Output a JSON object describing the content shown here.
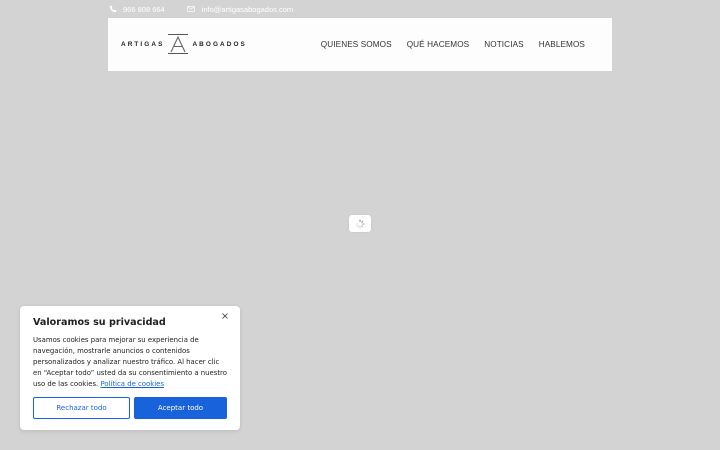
{
  "topbar": {
    "phone": "966 808 664",
    "phone_icon": "phone-icon",
    "email": "info@artigasabogados.com",
    "email_icon": "envelope-icon"
  },
  "header": {
    "logo_left": "ARTIGAS",
    "logo_right": "ABOGADOS",
    "logo_mark": "A",
    "nav": [
      "QUIENES SOMOS",
      "QUÉ HACEMOS",
      "NOTICIAS",
      "HABLEMOS"
    ]
  },
  "loader": {
    "icon": "spinner-icon"
  },
  "cookie": {
    "title": "Valoramos su privacidad",
    "body": "Usamos cookies para mejorar su experiencia de navegación, mostrarle anuncios o contenidos personalizados y analizar nuestro tráfico. Al hacer clic en “Aceptar todo” usted da su consentimiento a nuestro uso de las cookies.",
    "policy_link": "Política de cookies",
    "reject_label": "Rechazar todo",
    "accept_label": "Aceptar todo",
    "close_icon": "close-icon"
  },
  "colors": {
    "page_bg": "#d3d3d3",
    "accent": "#1863dc",
    "header_bg": "#fdfdfd"
  }
}
